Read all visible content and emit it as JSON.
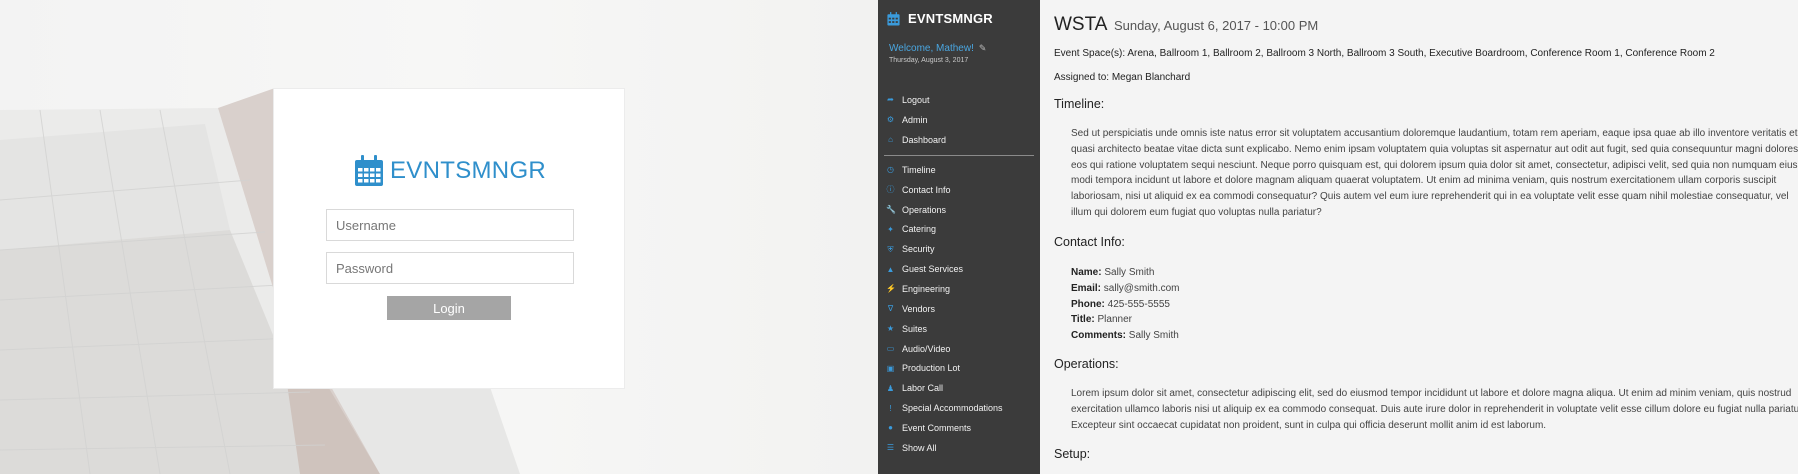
{
  "login": {
    "brand": "EVNTSMNGR",
    "username_placeholder": "Username",
    "password_placeholder": "Password",
    "login_label": "Login"
  },
  "sidebar": {
    "brand": "EVNTSMNGR",
    "welcome": "Welcome, Mathew!",
    "date": "Thursday, August 3, 2017",
    "top_items": [
      {
        "label": "Logout",
        "icon": "logout-icon"
      },
      {
        "label": "Admin",
        "icon": "gears-icon"
      },
      {
        "label": "Dashboard",
        "icon": "home-icon"
      }
    ],
    "items": [
      {
        "label": "Timeline",
        "icon": "clock-icon"
      },
      {
        "label": "Contact Info",
        "icon": "info-icon"
      },
      {
        "label": "Operations",
        "icon": "wrench-icon"
      },
      {
        "label": "Catering",
        "icon": "utensils-icon"
      },
      {
        "label": "Security",
        "icon": "shield-icon"
      },
      {
        "label": "Guest Services",
        "icon": "thumbs-up-icon"
      },
      {
        "label": "Engineering",
        "icon": "plug-icon"
      },
      {
        "label": "Vendors",
        "icon": "vendor-icon"
      },
      {
        "label": "Suites",
        "icon": "star-icon"
      },
      {
        "label": "Audio/Video",
        "icon": "laptop-icon"
      },
      {
        "label": "Production Lot",
        "icon": "truck-icon"
      },
      {
        "label": "Labor Call",
        "icon": "person-icon"
      },
      {
        "label": "Special Accommodations",
        "icon": "exclamation-icon"
      },
      {
        "label": "Event Comments",
        "icon": "comments-icon"
      },
      {
        "label": "Show All",
        "icon": "list-icon"
      }
    ]
  },
  "event": {
    "name": "WSTA",
    "when": "Sunday, August 6, 2017 - 10:00 PM",
    "spaces": "Event Space(s): Arena, Ballroom 1, Ballroom 2, Ballroom 3 North, Ballroom 3 South, Executive Boardroom, Conference Room 1, Conference Room 2",
    "assigned": "Assigned to: Megan Blanchard",
    "timeline_heading": "Timeline:",
    "timeline_lines": [
      "Sed ut perspiciatis unde omnis iste natus error sit voluptatem accusantium doloremque laudantium, totam rem aperiam, eaque ipsa quae ab illo inventore veritatis et",
      "quasi architecto beatae vitae dicta sunt explicabo. Nemo enim ipsam voluptatem quia voluptas sit aspernatur aut odit aut fugit, sed quia consequuntur magni dolores",
      "eos qui ratione voluptatem sequi nesciunt. Neque porro quisquam est, qui dolorem ipsum quia dolor sit amet, consectetur, adipisci velit, sed quia non numquam eius",
      "modi tempora incidunt ut labore et dolore magnam aliquam quaerat voluptatem. Ut enim ad minima veniam, quis nostrum exercitationem ullam corporis suscipit",
      "laboriosam, nisi ut aliquid ex ea commodi consequatur? Quis autem vel eum iure reprehenderit qui in ea voluptate velit esse quam nihil molestiae consequatur, vel",
      "illum qui dolorem eum fugiat quo voluptas nulla pariatur?"
    ],
    "contact_heading": "Contact Info:",
    "contact": [
      {
        "key": "Name:",
        "value": "Sally Smith"
      },
      {
        "key": "Email:",
        "value": "sally@smith.com"
      },
      {
        "key": "Phone:",
        "value": "425-555-5555"
      },
      {
        "key": "Title:",
        "value": "Planner"
      },
      {
        "key": "Comments:",
        "value": "Sally Smith"
      }
    ],
    "operations_heading": "Operations:",
    "operations_lines": [
      "Lorem ipsum dolor sit amet, consectetur adipiscing elit, sed do eiusmod tempor incididunt ut labore et dolore magna aliqua. Ut enim ad minim veniam, quis nostrud",
      "exercitation ullamco laboris nisi ut aliquip ex ea commodo consequat. Duis aute irure dolor in reprehenderit in voluptate velit esse cillum dolore eu fugiat nulla pariatur.",
      "Excepteur sint occaecat cupidatat non proident, sunt in culpa qui officia deserunt mollit anim id est laborum."
    ],
    "setup_heading": "Setup:"
  },
  "colors": {
    "accent": "#2f8fcb",
    "sidebar_bg": "#3b3b3b",
    "login_button": "#a5a5a5"
  }
}
